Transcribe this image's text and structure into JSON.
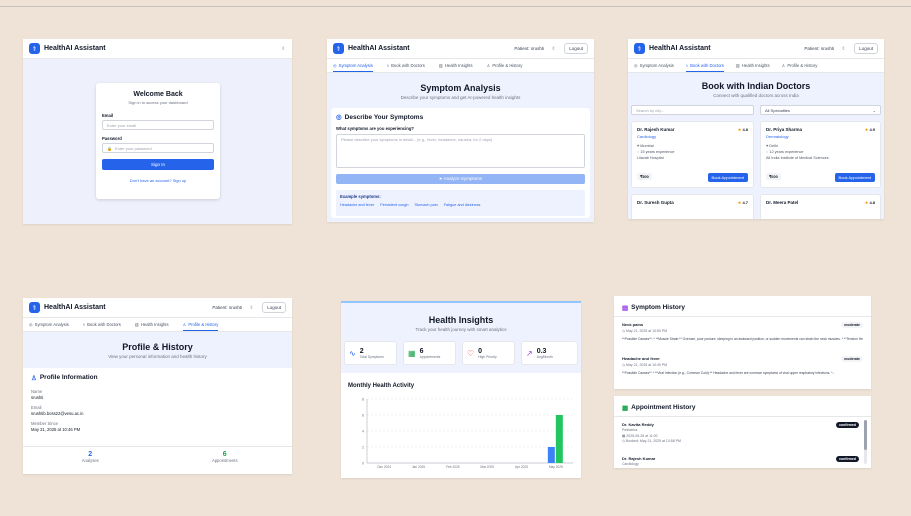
{
  "app": {
    "name": "HealthAI Assistant",
    "user": "Patient: srushti",
    "logout": "Logout"
  },
  "tabs": [
    "Symptom Analysis",
    "Book with Doctors",
    "Health Insights",
    "Profile & History"
  ],
  "login": {
    "title": "Welcome Back",
    "subtitle": "Sign in to access your dashboard",
    "email_label": "Email",
    "email_placeholder": "Enter your email",
    "password_label": "Password",
    "password_placeholder": "Enter your password",
    "signin": "Sign In",
    "signup_link": "Don't have an account? Sign up"
  },
  "symptom": {
    "title": "Symptom Analysis",
    "subtitle": "Describe your symptoms and get AI-powered health insights",
    "card_title": "Describe Your Symptoms",
    "question": "What symptoms are you experiencing?",
    "placeholder": "Please describe your symptoms in detail... (e.g., fever, headache, nausea, for 2 days)",
    "analyze": "Analyze Symptoms",
    "examples_label": "Example symptoms:",
    "examples": [
      "Headache and fever",
      "Persistent cough",
      "Stomach pain",
      "Fatigue and dizziness"
    ]
  },
  "doctors": {
    "title": "Book with Indian Doctors",
    "subtitle": "Connect with qualified doctors across India",
    "search_placeholder": "Search by city...",
    "filter": "All Specialties",
    "book": "Book Appointment",
    "list": [
      {
        "name": "Dr. Rajesh Kumar",
        "specialty": "Cardiology",
        "city": "Mumbai",
        "exp": "15 years experience",
        "hospital": "Lilavati Hospital",
        "rating": "4.8",
        "fee": "₹500"
      },
      {
        "name": "Dr. Priya Sharma",
        "specialty": "Dermatology",
        "city": "Delhi",
        "exp": "12 years experience",
        "hospital": "All India Institute of Medical Sciences",
        "rating": "4.9",
        "fee": "₹600"
      },
      {
        "name": "Dr. Suresh Gupta",
        "rating": "4.7"
      },
      {
        "name": "Dr. Meera Patel",
        "rating": "4.8"
      }
    ]
  },
  "profile": {
    "title": "Profile & History",
    "subtitle": "View your personal information and health history",
    "card_title": "Profile Information",
    "name_label": "Name",
    "name": "srushti",
    "email_label": "Email",
    "email": "srushtib.boss22@vesu.ac.in",
    "member_label": "Member Since",
    "member_since": "May 21, 2025 at 10:46 PM",
    "analyses_count": "2",
    "analyses_label": "Analyses",
    "appointments_count": "6",
    "appointments_label": "Appointments"
  },
  "insights": {
    "title": "Health Insights",
    "subtitle": "Track your health journey with smart analytics",
    "stats": [
      {
        "value": "2",
        "label": "Total Symptoms",
        "icon": "activity-icon",
        "color": "#2563eb"
      },
      {
        "value": "6",
        "label": "Appointments",
        "icon": "calendar-icon",
        "color": "#16a34a"
      },
      {
        "value": "0",
        "label": "High Priority",
        "icon": "heart-icon",
        "color": "#dc2626"
      },
      {
        "value": "0.3",
        "label": "Avg/Month",
        "icon": "trending-up-icon",
        "color": "#9333ea"
      }
    ],
    "chart_title": "Monthly Health Activity"
  },
  "chart_data": {
    "type": "bar",
    "categories": [
      "Dec 2024",
      "Jan 2025",
      "Feb 2025",
      "Mar 2025",
      "Apr 2025",
      "May 2025"
    ],
    "series": [
      {
        "values": [
          0,
          0,
          0,
          0,
          0,
          2
        ],
        "color": "#3b82f6"
      },
      {
        "values": [
          0,
          0,
          0,
          0,
          0,
          6
        ],
        "color": "#22c55e"
      }
    ],
    "ylim": [
      0,
      8
    ],
    "yticks": [
      0,
      2,
      4,
      6,
      8
    ],
    "grid": true
  },
  "history": {
    "symptom_title": "Symptom History",
    "items": [
      {
        "title": "Neck pains",
        "date": "May 21, 2025 at 10:50 PM",
        "badge": "moderate",
        "text": "**Possible Causes**: * **Muscle Strain:** Overuse, poor posture, sleeping in an awkward position, or sudden movements can strain the neck muscles. * **Tension Heada..."
      },
      {
        "title": "Headache and fever",
        "date": "May 21, 2025 at 10:49 PM",
        "badge": "moderate",
        "text": "**Possible Causes** * **Viral Infection (e.g., Common Cold):** Headache and fever are common symptoms of viral upper respiratory infections. *..."
      }
    ],
    "appt_title": "Appointment History",
    "appointments": [
      {
        "name": "Dr. Kavita Reddy",
        "specialty": "Pediatrics",
        "date": "2025-05-26 at 11:00",
        "booked": "Booked: May 21, 2025 at 10:58 PM",
        "badge": "confirmed"
      },
      {
        "name": "Dr. Rajesh Kumar",
        "specialty": "Cardiology",
        "badge": "confirmed"
      }
    ]
  }
}
